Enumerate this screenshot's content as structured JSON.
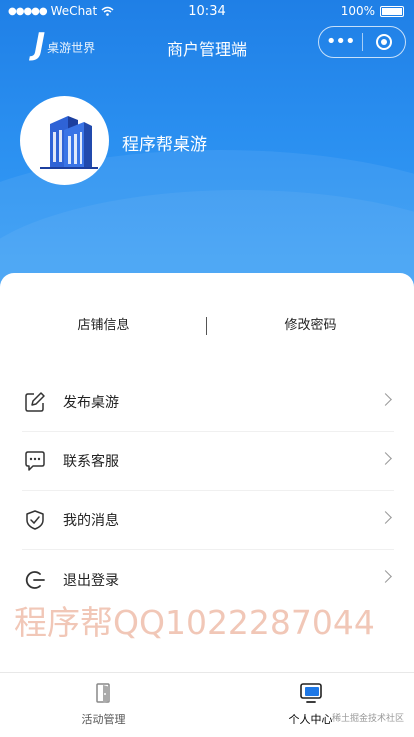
{
  "status_bar": {
    "carrier": "WeChat",
    "time": "10:34",
    "battery": "100%"
  },
  "nav": {
    "logo_text": "桌游世界",
    "title": "商户管理端"
  },
  "profile": {
    "shop_name": "程序帮桌游"
  },
  "actions": {
    "store_info": "店铺信息",
    "change_password": "修改密码"
  },
  "menu": [
    {
      "label": "发布桌游",
      "icon": "edit-icon"
    },
    {
      "label": "联系客服",
      "icon": "chat-icon"
    },
    {
      "label": "我的消息",
      "icon": "shield-check-icon"
    },
    {
      "label": "退出登录",
      "icon": "logout-icon"
    }
  ],
  "watermark": "程序帮QQ1022287044",
  "tabs": [
    {
      "label": "活动管理",
      "icon": "door-icon",
      "active": false
    },
    {
      "label": "个人中心",
      "icon": "monitor-icon",
      "active": true
    }
  ],
  "corner_mark": "稀土掘金技术社区",
  "colors": {
    "brand": "#1f7fe6",
    "tab_active_icon": "#1e78e6"
  }
}
